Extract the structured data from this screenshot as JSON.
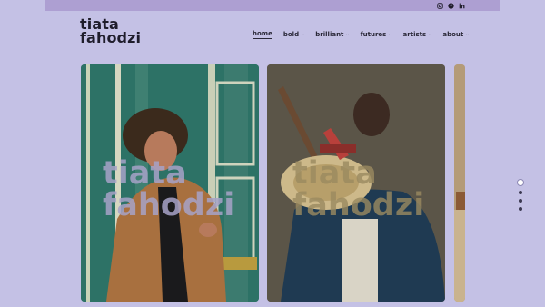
{
  "site": {
    "logo_line1": "tiata",
    "logo_line2": "fahodzi"
  },
  "social": [
    "instagram-icon",
    "facebook-icon",
    "linkedin-icon"
  ],
  "nav": [
    {
      "label": "home",
      "active": true,
      "dropdown": false
    },
    {
      "label": "bold",
      "active": false,
      "dropdown": true
    },
    {
      "label": "brilliant",
      "active": false,
      "dropdown": true
    },
    {
      "label": "futures",
      "active": false,
      "dropdown": true
    },
    {
      "label": "artists",
      "active": false,
      "dropdown": true
    },
    {
      "label": "about",
      "active": false,
      "dropdown": true
    }
  ],
  "slides": [
    {
      "watermark_line1": "tiata",
      "watermark_line2": "fahodzi"
    },
    {
      "watermark_line1": "tiata",
      "watermark_line2": "fahodzi"
    }
  ],
  "pager": {
    "count": 4,
    "active_index": 0
  },
  "colors": {
    "background": "#c4c1e5",
    "top_strip": "#ad9fd2",
    "text": "#1f1d2b"
  }
}
